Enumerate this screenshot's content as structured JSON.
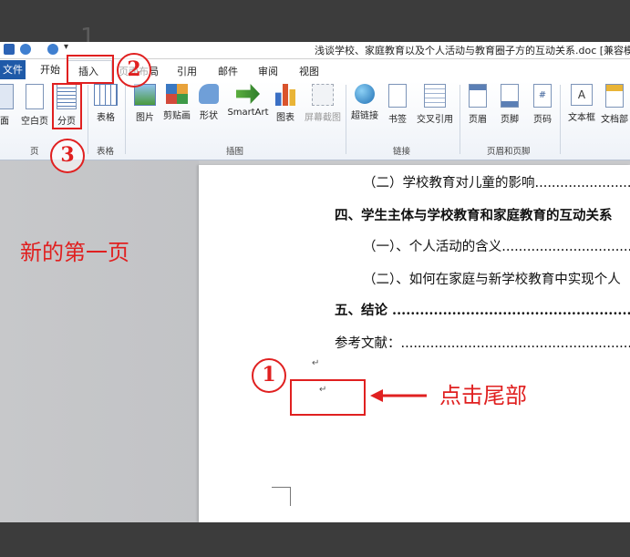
{
  "window": {
    "corner_number": "1",
    "title": "浅谈学校、家庭教育以及个人活动与教育圈子方的互动关系.doc [兼容模式] -"
  },
  "tabs": {
    "file": "文件",
    "home": "开始",
    "insert": "插入",
    "layout": "页面布局",
    "references": "引用",
    "mailings": "邮件",
    "review": "审阅",
    "view": "视图"
  },
  "ribbon": {
    "cover_page": "面",
    "blank_page": "空白页",
    "page_break": "分页",
    "table": "表格",
    "picture": "图片",
    "clip_art": "剪贴画",
    "shapes": "形状",
    "smartart": "SmartArt",
    "chart": "图表",
    "screenshot": "屏幕截图",
    "hyperlink": "超链接",
    "bookmark": "书签",
    "cross_reference": "交叉引用",
    "header": "页眉",
    "footer": "页脚",
    "page_number": "页码",
    "text_box": "文本框",
    "doc_parts": "文档部",
    "groups": {
      "pages": "页",
      "tables": "表格",
      "illustrations": "插图",
      "links": "链接",
      "header_footer": "页眉和页脚"
    }
  },
  "document": {
    "lines": [
      "（二）学校教育对儿童的影响.............................",
      "四、学生主体与学校教育和家庭教育的互动关系",
      "（一）、个人活动的含义.....................................",
      "（二）、如何在家庭与新学校教育中实现个人",
      "五、结论 .........................................................",
      "参考文献：........................................................"
    ],
    "paragraph_mark": "↵"
  },
  "annotations": {
    "new_first_page": "新的第一页",
    "click_end": "点击尾部",
    "step1": "1",
    "step2": "2",
    "step3": "3"
  },
  "colors": {
    "annotation_red": "#e02020",
    "file_tab_blue": "#1f5aa8"
  }
}
